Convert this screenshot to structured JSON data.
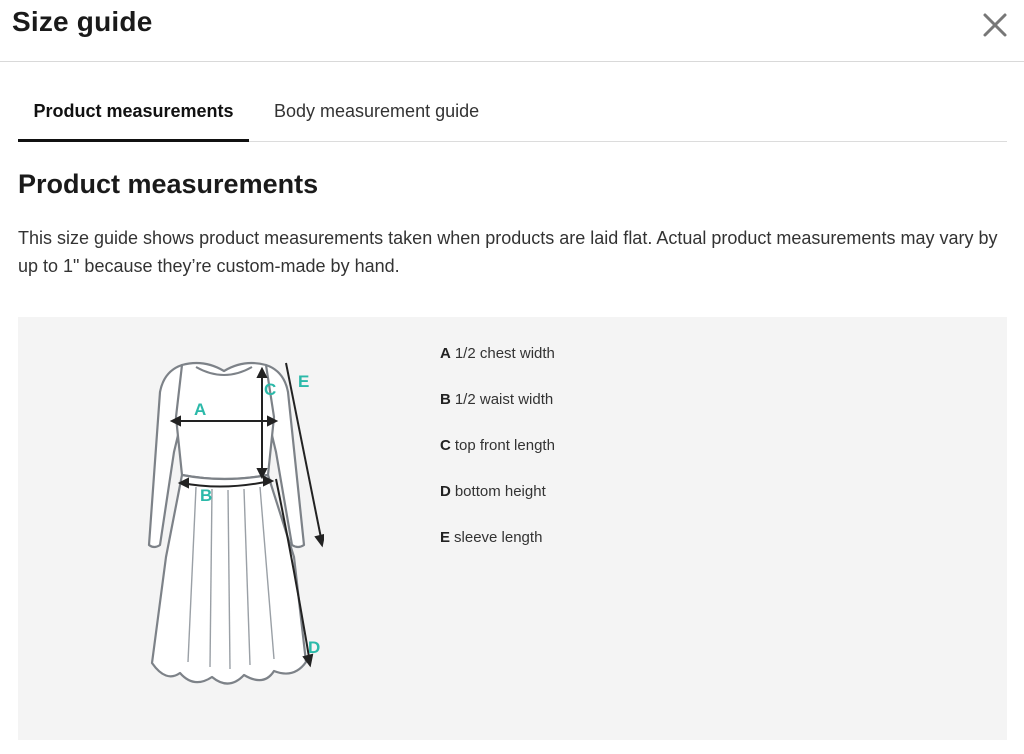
{
  "header": {
    "title": "Size guide",
    "close_icon": "close-icon"
  },
  "tabs": [
    {
      "label": "Product measurements",
      "active": true
    },
    {
      "label": "Body measurement guide",
      "active": false
    }
  ],
  "content": {
    "heading": "Product measurements",
    "description": "This size guide shows product measurements taken when products are laid flat. Actual product measurements may vary by up to 1\" because they’re custom-made by hand."
  },
  "diagram": {
    "labels": [
      "A",
      "B",
      "C",
      "D",
      "E"
    ],
    "accent_color": "#2bb9a9",
    "icon": "dress-illustration"
  },
  "legend": [
    {
      "letter": "A",
      "text": "1/2 chest width"
    },
    {
      "letter": "B",
      "text": "1/2 waist width"
    },
    {
      "letter": "C",
      "text": "top front length"
    },
    {
      "letter": "D",
      "text": "bottom height"
    },
    {
      "letter": "E",
      "text": "sleeve length"
    }
  ]
}
